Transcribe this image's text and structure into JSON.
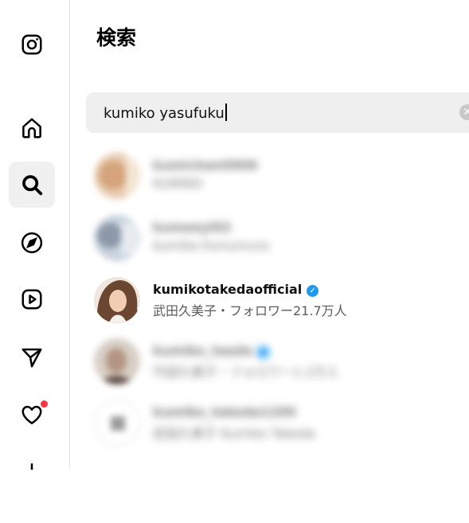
{
  "page": {
    "title": "検索"
  },
  "search": {
    "value": "kumiko yasufuku",
    "clear_glyph": "✕"
  },
  "nav": [
    {
      "icon": "instagram-logo-icon"
    },
    {
      "icon": "home-icon"
    },
    {
      "icon": "search-icon",
      "active": true
    },
    {
      "icon": "explore-compass-icon"
    },
    {
      "icon": "reels-icon"
    },
    {
      "icon": "messages-send-icon"
    },
    {
      "icon": "notifications-heart-icon",
      "has_dot": true
    },
    {
      "icon": "create-plus-icon"
    }
  ],
  "results": [
    {
      "username": "kumichan0906",
      "subtitle": "KUMIKO",
      "blurred": true
    },
    {
      "username": "kumeeyl02",
      "subtitle": "kumiko.fumumura",
      "blurred": true
    },
    {
      "username": "kumikotakedaofficial",
      "verified": true,
      "subtitle": "武田久美子・フォロワー21.7万人",
      "blurred": false
    },
    {
      "username": "kumiko_taada",
      "verified": true,
      "subtitle": "竹田久美子・フォロワー1.2万人",
      "blurred": true
    },
    {
      "username": "kumiko_takeda1209",
      "subtitle": "武田久美子 Kumiko Takeda",
      "blurred": true
    }
  ],
  "colors": {
    "notification_dot": "#ff3040",
    "verified_badge": "#1d9bf0",
    "search_bg": "#efefef",
    "active_nav_bg": "#f0f0f0"
  }
}
